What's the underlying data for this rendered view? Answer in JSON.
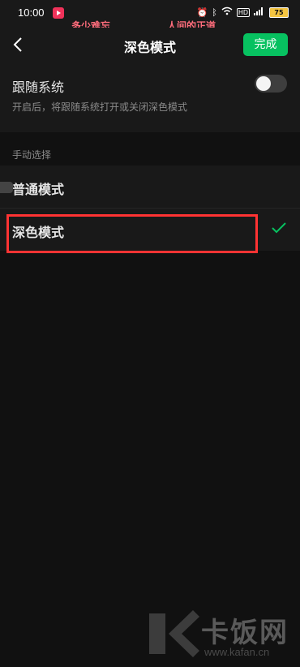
{
  "status_bar": {
    "time": "10:00",
    "hd": "HD",
    "battery": "75",
    "lyric_left": "多少难忘",
    "lyric_right": "人间的正道"
  },
  "header": {
    "back_icon": "chevron-left-icon",
    "title": "深色模式",
    "done_label": "完成"
  },
  "follow_system": {
    "label": "跟随系统",
    "description": "开启后，将跟随系统打开或关闭深色模式",
    "enabled": false
  },
  "manual": {
    "section_title": "手动选择",
    "options": [
      {
        "label": "普通模式",
        "selected": false
      },
      {
        "label": "深色模式",
        "selected": true
      }
    ]
  },
  "colors": {
    "accent": "#07c160",
    "background": "#111111",
    "surface": "#191919",
    "highlight": "#ff3333"
  },
  "watermark": {
    "text": "卡饭网",
    "url": "www.kafan.cn"
  }
}
